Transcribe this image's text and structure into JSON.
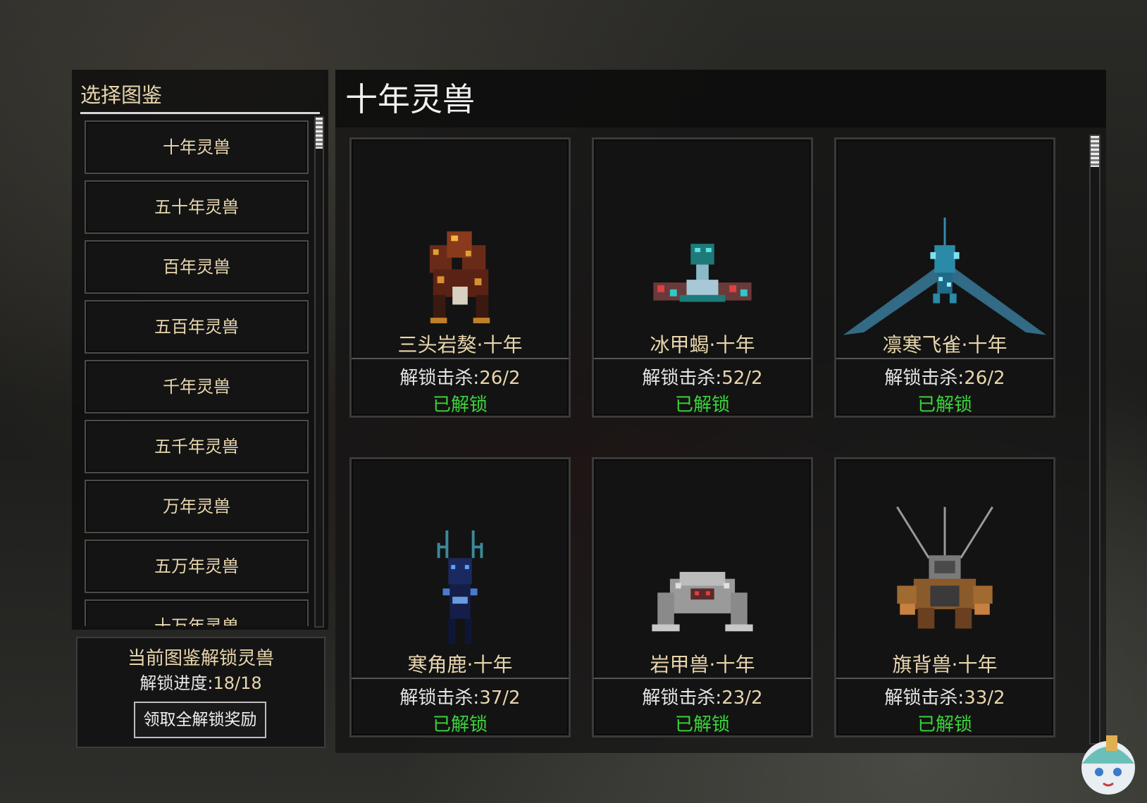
{
  "sidebar": {
    "title": "选择图鉴",
    "items": [
      {
        "label": "十年灵兽"
      },
      {
        "label": "五十年灵兽"
      },
      {
        "label": "百年灵兽"
      },
      {
        "label": "五百年灵兽"
      },
      {
        "label": "千年灵兽"
      },
      {
        "label": "五千年灵兽"
      },
      {
        "label": "万年灵兽"
      },
      {
        "label": "五万年灵兽"
      },
      {
        "label": "十万年灵兽"
      }
    ]
  },
  "summary": {
    "title": "当前图鉴解锁灵兽",
    "progress_label": "解锁进度:",
    "progress_value": "18/18",
    "reward_button": "领取全解锁奖励"
  },
  "main": {
    "title": "十年灵兽",
    "cards": [
      {
        "name": "三头岩獒·十年",
        "kills_label": "解锁击杀:",
        "kills_value": "26/2",
        "status": "已解锁",
        "icon": "three-headed-rock-mastiff-icon"
      },
      {
        "name": "冰甲蝎·十年",
        "kills_label": "解锁击杀:",
        "kills_value": "52/2",
        "status": "已解锁",
        "icon": "ice-armor-scorpion-icon"
      },
      {
        "name": "凛寒飞雀·十年",
        "kills_label": "解锁击杀:",
        "kills_value": "26/2",
        "status": "已解锁",
        "icon": "frost-sparrow-icon"
      },
      {
        "name": "寒角鹿·十年",
        "kills_label": "解锁击杀:",
        "kills_value": "37/2",
        "status": "已解锁",
        "icon": "frost-horn-deer-icon"
      },
      {
        "name": "岩甲兽·十年",
        "kills_label": "解锁击杀:",
        "kills_value": "23/2",
        "status": "已解锁",
        "icon": "rock-armor-beast-icon"
      },
      {
        "name": "旗背兽·十年",
        "kills_label": "解锁击杀:",
        "kills_value": "33/2",
        "status": "已解锁",
        "icon": "flag-back-beast-icon"
      }
    ]
  },
  "colors": {
    "accent_text": "#e8d6ad",
    "unlocked": "#3bd43b",
    "panel_bg": "#141414"
  }
}
